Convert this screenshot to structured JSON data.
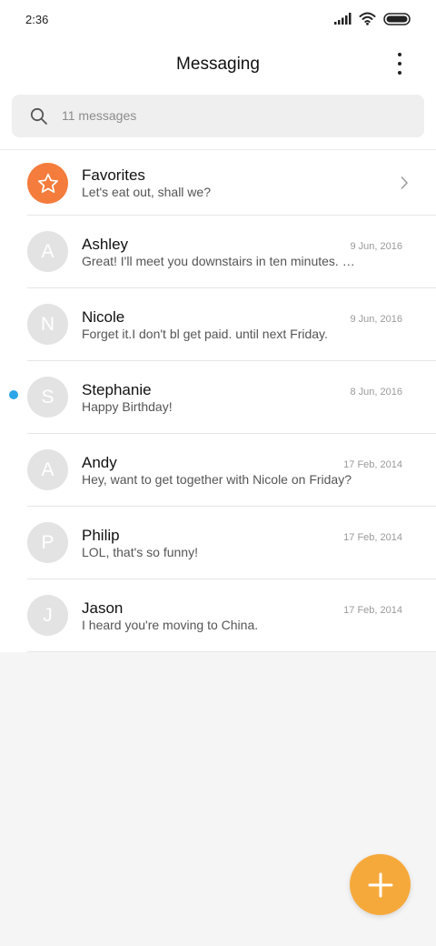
{
  "status_bar": {
    "time": "2:36"
  },
  "header": {
    "title": "Messaging"
  },
  "search": {
    "placeholder": "11 messages"
  },
  "favorites": {
    "name": "Favorites",
    "preview": "Let's eat out, shall we?"
  },
  "conversations": [
    {
      "initial": "A",
      "name": "Ashley",
      "preview": "Great! I'll meet you downstairs in ten minutes. D...",
      "date": "9 Jun, 2016",
      "unread": false
    },
    {
      "initial": "N",
      "name": "Nicole",
      "preview": "Forget it.I don't bl get paid. until next Friday.",
      "date": "9 Jun, 2016",
      "unread": false
    },
    {
      "initial": "S",
      "name": "Stephanie",
      "preview": "Happy Birthday!",
      "date": "8 Jun, 2016",
      "unread": true
    },
    {
      "initial": "A",
      "name": "Andy",
      "preview": "Hey, want to get together with Nicole on Friday?",
      "date": "17 Feb, 2014",
      "unread": false
    },
    {
      "initial": "P",
      "name": "Philip",
      "preview": "LOL, that's so funny!",
      "date": "17 Feb, 2014",
      "unread": false
    },
    {
      "initial": "J",
      "name": "Jason",
      "preview": "I heard you're moving to China.",
      "date": "17 Feb, 2014",
      "unread": false
    }
  ],
  "icons": {
    "signal": "signal-icon",
    "wifi": "wifi-icon",
    "battery": "battery-icon",
    "more": "more-vertical-icon",
    "search": "search-icon",
    "favorites": "star-icon",
    "chevron": "chevron-right-icon",
    "compose": "plus-icon"
  },
  "colors": {
    "favorites_avatar": "#f47c3c",
    "fab": "#f6a93b",
    "unread_dot": "#2aa6e8",
    "avatar_grey": "#e3e3e3"
  }
}
